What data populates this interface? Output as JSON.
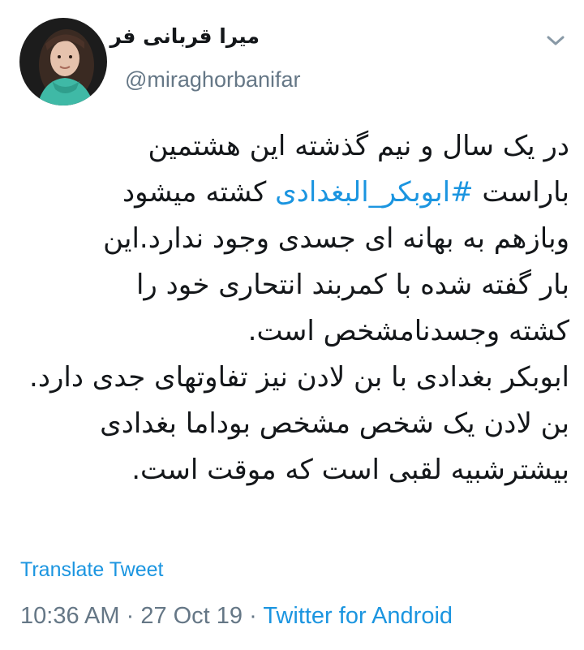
{
  "author": {
    "display_name": "میرا قربانی فر",
    "handle": "@miraghorbanifar",
    "avatar_icon": "profile-photo"
  },
  "menu": {
    "icon": "chevron-down-icon"
  },
  "tweet": {
    "line1": "در یک سال و نیم گذشته این هشتمین",
    "line2_before": "باراست ",
    "hashtag": "#ابوبکر_البغدادی",
    "line2_after": " کشته میشود",
    "line3": "وبازهم به بهانه ای جسدی وجود ندارد.این",
    "line4": "بار گفته شده با کمربند انتحاری خود را",
    "line5": "کشته وجسدنامشخص است.",
    "line6": "ابوبکر بغدادی با بن لادن نیز تفاوتهای جدی دارد.",
    "line7": "بن لادن یک شخص مشخص بوداما بغدادی",
    "line8": "بیشترشبیه لقبی است که موقت است."
  },
  "translate_label": "Translate Tweet",
  "meta": {
    "time": "10:36 AM",
    "separator": " · ",
    "date": "27 Oct 19",
    "source": "Twitter for Android"
  },
  "colors": {
    "link": "#1b95e0",
    "muted": "#657786",
    "text": "#14171a"
  }
}
